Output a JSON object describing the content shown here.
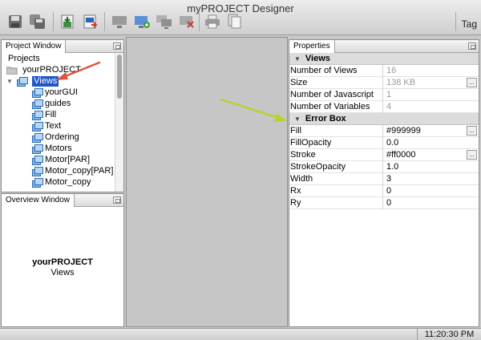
{
  "window": {
    "title": "myPROJECT Designer"
  },
  "toolbar": {
    "tag_label": "Tag"
  },
  "project_window": {
    "tab_label": "Project Window",
    "root_label": "Projects",
    "project_name": "yourPROJECT",
    "views_label": "Views",
    "items": [
      "yourGUI",
      "guides",
      "Fill",
      "Text",
      "Ordering",
      "Motors",
      "Motor[PAR]",
      "Motor_copy[PAR]",
      "Motor_copy"
    ]
  },
  "overview_window": {
    "tab_label": "Overview Window",
    "project_name": "yourPROJECT",
    "subtitle": "Views"
  },
  "properties": {
    "tab_label": "Properties",
    "views_group": {
      "label": "Views",
      "rows": [
        {
          "name": "Number of Views",
          "value": "16"
        },
        {
          "name": "Size",
          "value": "138 KB"
        },
        {
          "name": "Number of Javascript",
          "value": "1"
        },
        {
          "name": "Number of Variables",
          "value": "4"
        }
      ]
    },
    "error_group": {
      "label": "Error Box",
      "rows": [
        {
          "name": "Fill",
          "value": "#999999"
        },
        {
          "name": "FillOpacity",
          "value": "0.0"
        },
        {
          "name": "Stroke",
          "value": "#ff0000"
        },
        {
          "name": "StrokeOpacity",
          "value": "1.0"
        },
        {
          "name": "Width",
          "value": "3"
        },
        {
          "name": "Rx",
          "value": "0"
        },
        {
          "name": "Ry",
          "value": "0"
        }
      ]
    },
    "ellipsis": "..."
  },
  "status": {
    "time": "11:20:30 PM"
  },
  "colors": {
    "selection": "#2255c8",
    "arrow_red": "#e0553f",
    "arrow_green": "#b5d334"
  }
}
